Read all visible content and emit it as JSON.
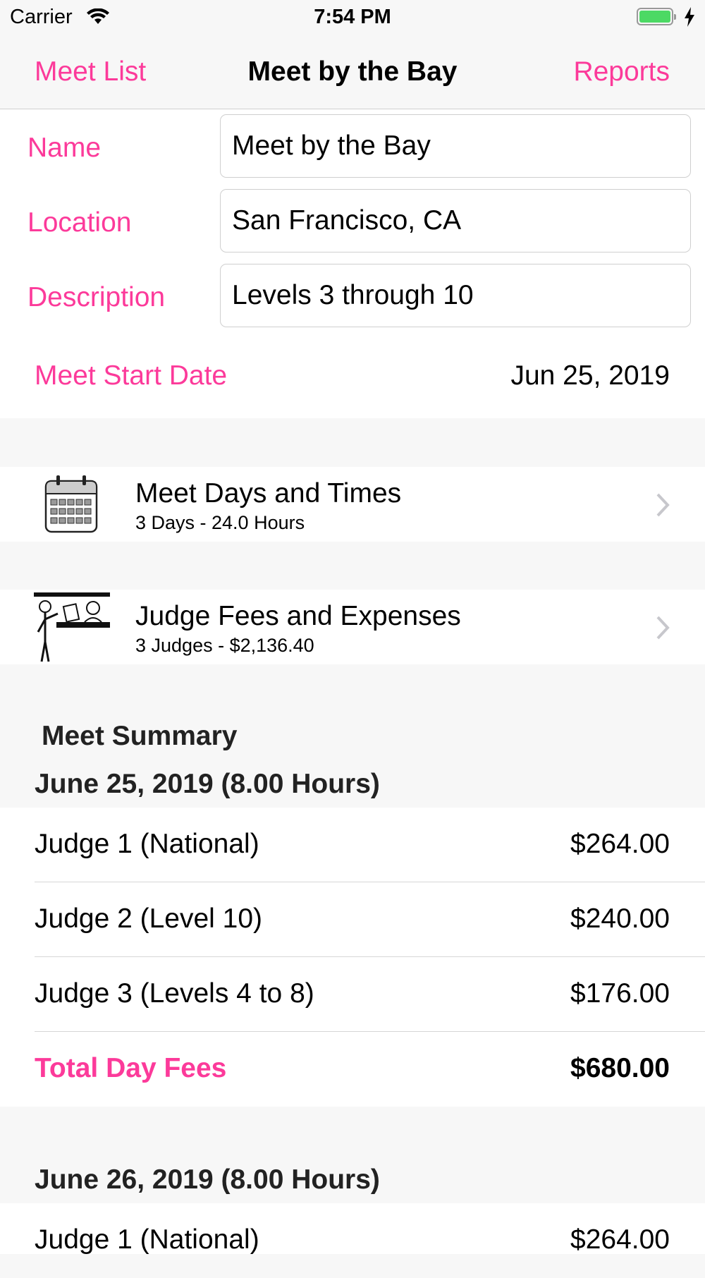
{
  "status_bar": {
    "carrier": "Carrier",
    "time": "7:54 PM"
  },
  "nav": {
    "back_label": "Meet List",
    "title": "Meet by the Bay",
    "right_label": "Reports"
  },
  "form": {
    "name_label": "Name",
    "name_value": "Meet by the Bay",
    "location_label": "Location",
    "location_value": "San Francisco, CA",
    "description_label": "Description",
    "description_value": "Levels 3 through 10",
    "start_date_label": "Meet Start Date",
    "start_date_value": "Jun 25, 2019"
  },
  "cells": {
    "days": {
      "title": "Meet Days and Times",
      "subtitle": "3 Days - 24.0 Hours",
      "icon": "calendar-icon"
    },
    "judges": {
      "title": "Judge Fees and Expenses",
      "subtitle": "3 Judges - $2,136.40",
      "icon": "judges-icon"
    }
  },
  "summary": {
    "heading": "Meet Summary",
    "days": [
      {
        "header": "June 25, 2019 (8.00 Hours)",
        "rows": [
          {
            "label": "Judge 1 (National)",
            "amount": "$264.00"
          },
          {
            "label": "Judge 2 (Level 10)",
            "amount": "$240.00"
          },
          {
            "label": "Judge 3 (Levels 4 to 8)",
            "amount": "$176.00"
          }
        ],
        "total_label": "Total Day Fees",
        "total_amount": "$680.00"
      },
      {
        "header": "June 26, 2019 (8.00 Hours)",
        "rows": [
          {
            "label": "Judge 1 (National)",
            "amount": "$264.00"
          }
        ]
      }
    ]
  },
  "colors": {
    "accent": "#fc3a9a",
    "battery": "#4cd964",
    "background": "#f7f7f7"
  }
}
